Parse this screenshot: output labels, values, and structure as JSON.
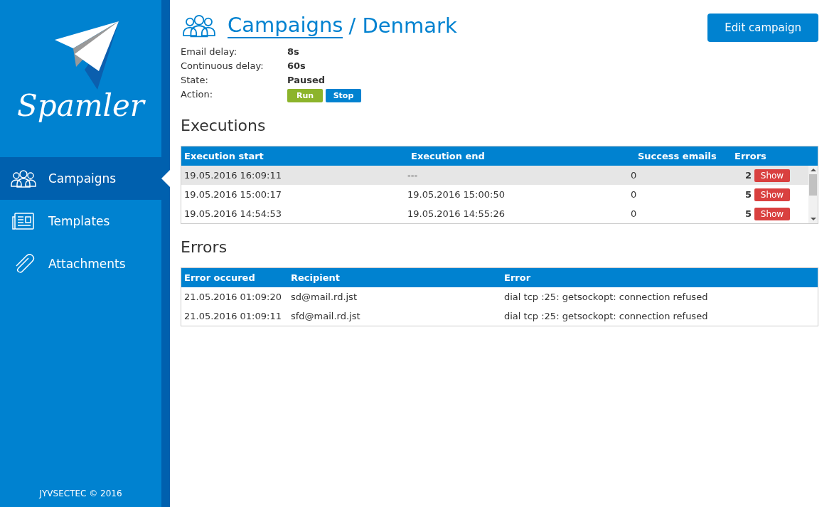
{
  "sidebar": {
    "logo_text": "Spamler",
    "items": [
      {
        "label": "Campaigns",
        "kind": "campaigns",
        "selected": true
      },
      {
        "label": "Templates",
        "kind": "templates",
        "selected": false
      },
      {
        "label": "Attachments",
        "kind": "attachments",
        "selected": false
      }
    ],
    "footer": "JYVSECTEC © 2016"
  },
  "header": {
    "breadcrumb_link": "Campaigns",
    "breadcrumb_rest": "/ Denmark",
    "edit_button": "Edit campaign"
  },
  "details": [
    {
      "label": "Email delay:",
      "value": "8s"
    },
    {
      "label": "Continuous delay:",
      "value": "60s"
    },
    {
      "label": "State:",
      "value": "Paused"
    }
  ],
  "action": {
    "label": "Action:",
    "buttons": [
      {
        "label": "Run",
        "kind": "run"
      },
      {
        "label": "Stop",
        "kind": "stop"
      }
    ]
  },
  "executions": {
    "title": "Executions",
    "columns": [
      "Execution start",
      "Execution end",
      "Success emails",
      "Errors"
    ],
    "rows": [
      {
        "start": "19.05.2016 16:09:11",
        "end": "---",
        "success": "0",
        "errors": "2",
        "button": "Show",
        "selected": true
      },
      {
        "start": "19.05.2016 15:00:17",
        "end": "19.05.2016 15:00:50",
        "success": "0",
        "errors": "5",
        "button": "Show",
        "selected": false
      },
      {
        "start": "19.05.2016 14:54:53",
        "end": "19.05.2016 14:55:26",
        "success": "0",
        "errors": "5",
        "button": "Show",
        "selected": false
      }
    ]
  },
  "errors": {
    "title": "Errors",
    "columns": [
      "Error occured",
      "Recipient",
      "Error"
    ],
    "rows": [
      [
        "21.05.2016 01:09:20",
        "sd@mail.rd.jst",
        "dial tcp :25: getsockopt: connection refused"
      ],
      [
        "21.05.2016 01:09:11",
        "sfd@mail.rd.jst",
        "dial tcp :25: getsockopt: connection refused"
      ]
    ]
  }
}
